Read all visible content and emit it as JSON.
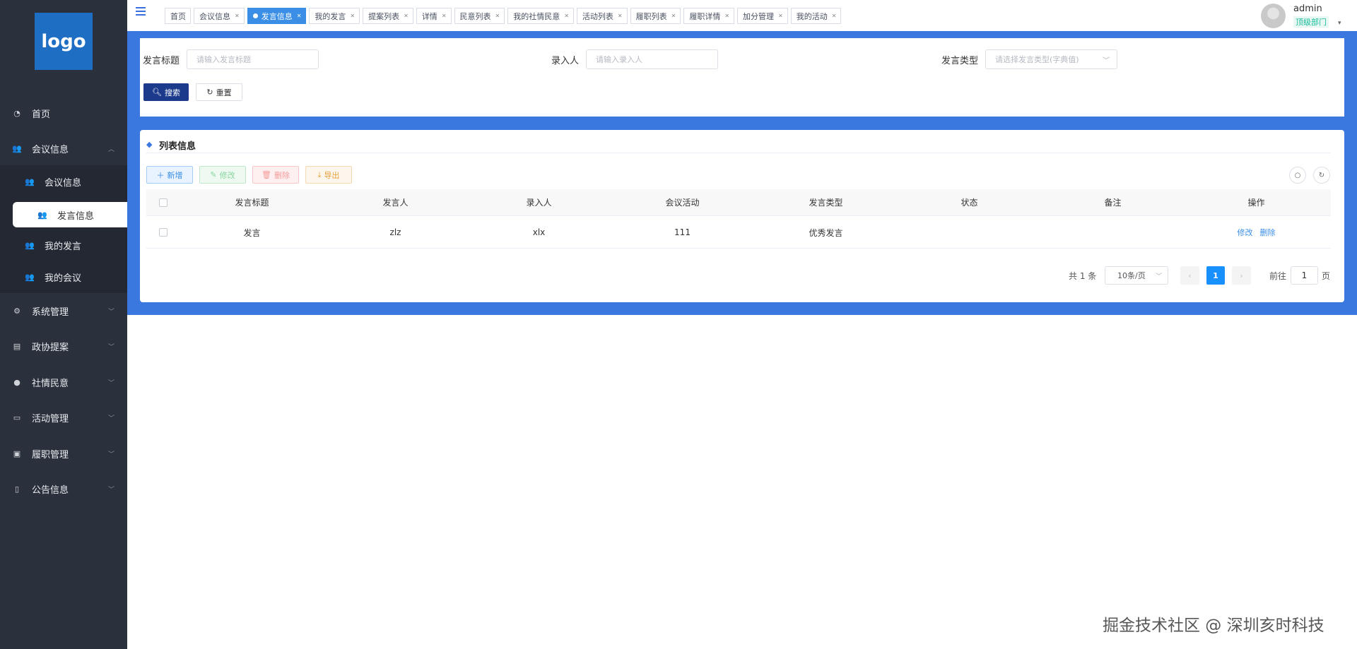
{
  "sidebar": {
    "logo": "logo",
    "items": [
      {
        "label": "首页",
        "icon": "dashboard-icon"
      },
      {
        "label": "会议信息",
        "icon": "user-icon"
      },
      {
        "label": "会议信息",
        "icon": "user-icon"
      },
      {
        "label": "发言信息",
        "icon": "user-icon"
      },
      {
        "label": "我的发言",
        "icon": "user-icon"
      },
      {
        "label": "我的会议",
        "icon": "user-icon"
      },
      {
        "label": "系统管理",
        "icon": "gear-icon"
      },
      {
        "label": "政协提案",
        "icon": "document-icon"
      },
      {
        "label": "社情民意",
        "icon": "person-icon"
      },
      {
        "label": "活动管理",
        "icon": "monitor-icon"
      },
      {
        "label": "履职管理",
        "icon": "briefcase-icon"
      },
      {
        "label": "公告信息",
        "icon": "phone-icon"
      }
    ]
  },
  "topbar": {
    "tabs": [
      {
        "label": "首页"
      },
      {
        "label": "会议信息"
      },
      {
        "label": "发言信息"
      },
      {
        "label": "我的发言"
      },
      {
        "label": "提案列表"
      },
      {
        "label": "详情"
      },
      {
        "label": "民意列表"
      },
      {
        "label": "我的社情民意"
      },
      {
        "label": "活动列表"
      },
      {
        "label": "履职列表"
      },
      {
        "label": "履职详情"
      },
      {
        "label": "加分管理"
      },
      {
        "label": "我的活动"
      }
    ],
    "active_tab": "发言信息",
    "user": {
      "name": "admin",
      "dept": "顶级部门"
    }
  },
  "search": {
    "fields": [
      {
        "label": "发言标题",
        "placeholder": "请输入发言标题"
      },
      {
        "label": "录入人",
        "placeholder": "请输入录入人"
      },
      {
        "label": "发言类型",
        "placeholder": "请选择发言类型(字典值)"
      }
    ],
    "search_btn": "搜索",
    "reset_btn": "重置"
  },
  "list": {
    "title": "列表信息",
    "add_btn": "新增",
    "edit_btn": "修改",
    "delete_btn": "删除",
    "export_btn": "导出",
    "columns": [
      "发言标题",
      "发言人",
      "录入人",
      "会议活动",
      "发言类型",
      "状态",
      "备注",
      "操作"
    ],
    "rows": [
      {
        "title": "发言",
        "speaker": "zlz",
        "recorder": "xlx",
        "meeting": "111",
        "type": "优秀发言",
        "status": "",
        "remark": "",
        "edit": "修改",
        "delete": "删除"
      }
    ]
  },
  "pagination": {
    "total_text": "共 1 条",
    "page_size": "10条/页",
    "current": "1",
    "goto_label": "前往",
    "goto_value": "1",
    "page_suffix": "页"
  },
  "watermark": "掘金技术社区 @ 深圳亥时科技",
  "colors": {
    "sidebar": "#2b313c",
    "accent": "#3a78e0",
    "active_tab": "#3a8ee6",
    "primary_btn": "#1b3a8c"
  }
}
